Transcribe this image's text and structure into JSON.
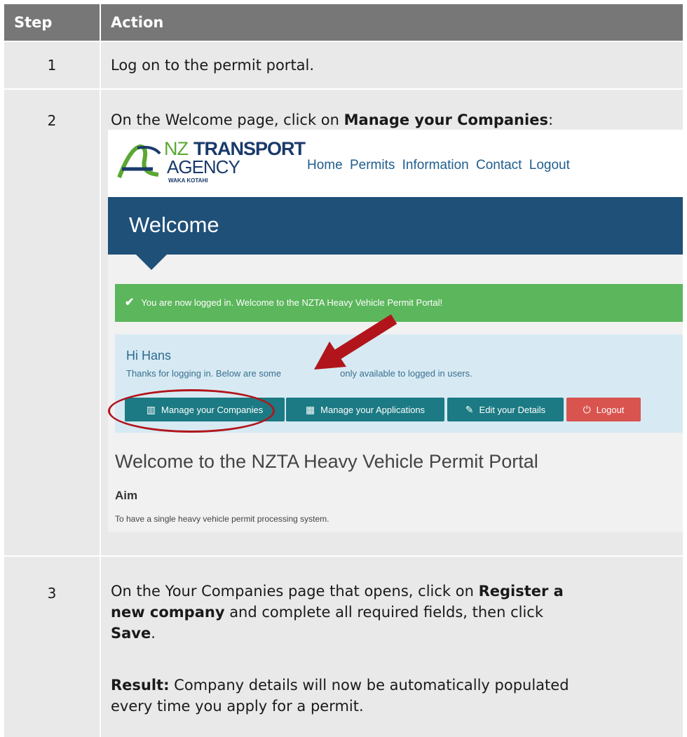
{
  "table": {
    "header_step": "Step",
    "header_action": "Action",
    "rows": [
      {
        "step": "1",
        "text": "Log on to the permit portal."
      },
      {
        "step": "2",
        "pre": "On the Welcome page, click on ",
        "bold": "Manage your Companies",
        "post": ":"
      },
      {
        "step": "3",
        "line1_pre": "On the Your Companies page that opens, click on ",
        "line1_bold": "Register a",
        "line2_bold": "new company",
        "line2_post": " and complete all required fields, then click",
        "line3_bold": "Save",
        "line3_post": ".",
        "result_label": "Result:",
        "result_text1": " Company details will now be automatically populated",
        "result_text2": "every time you apply for a permit."
      }
    ]
  },
  "screenshot": {
    "logo": {
      "nz": "NZ",
      "transport": "TRANSPORT",
      "agency": "AGENCY",
      "waka": "WAKA KOTAHI"
    },
    "nav": [
      "Home",
      "Permits",
      "Information",
      "Contact",
      "Logout"
    ],
    "banner_title": "Welcome",
    "alert_text": "You are now logged in. Welcome to the NZTA Heavy Vehicle Permit Portal!",
    "greeting": "Hi Hans",
    "thanks_pre": "Thanks for logging in. Below are some",
    "thanks_post": "only available to logged in users.",
    "buttons": {
      "companies": "Manage your Companies",
      "applications": "Manage your Applications",
      "details": "Edit your Details",
      "logout": "Logout"
    },
    "heading": "Welcome to the NZTA Heavy Vehicle Permit Portal",
    "aim_title": "Aim",
    "aim_text": "To have a single heavy vehicle permit processing system."
  },
  "colors": {
    "header": "#777777",
    "cell": "#e9e9e9",
    "banner": "#1f5078",
    "alert": "#5cb65c",
    "panel": "#d7eaf3",
    "button": "#1b7a83",
    "logout": "#d9534f",
    "highlight": "#b1151b"
  }
}
